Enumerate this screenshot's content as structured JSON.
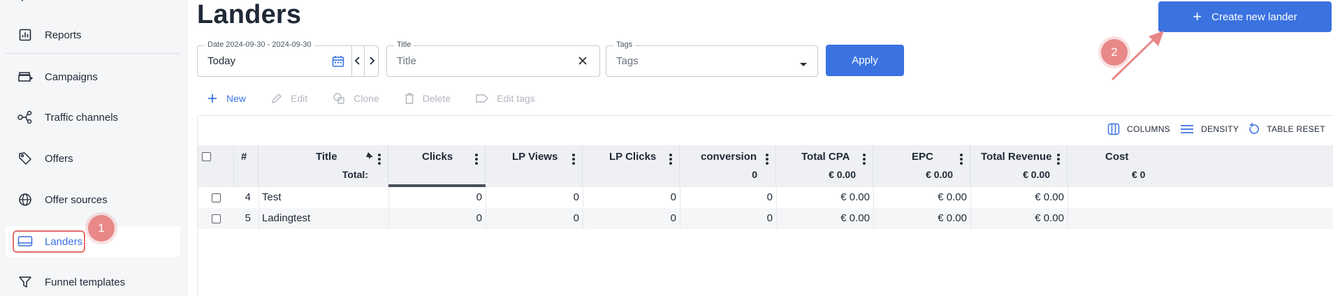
{
  "sidebar": {
    "items": [
      {
        "label": "Reports",
        "icon": "bar-chart-icon"
      },
      {
        "label": "Campaigns",
        "icon": "campaign-icon"
      },
      {
        "label": "Traffic channels",
        "icon": "share-nodes-icon"
      },
      {
        "label": "Offers",
        "icon": "tag-icon"
      },
      {
        "label": "Offer sources",
        "icon": "globe-icon"
      },
      {
        "label": "Landers",
        "icon": "monitor-icon"
      },
      {
        "label": "Funnel templates",
        "icon": "filter-icon"
      }
    ],
    "active": "Landers"
  },
  "annotations": {
    "badge_1": "1",
    "badge_2": "2"
  },
  "page": {
    "title": "Landers"
  },
  "create_button": {
    "label": "Create new lander"
  },
  "filters": {
    "date": {
      "label": "Date 2024-09-30 - 2024-09-30",
      "value": "Today"
    },
    "title": {
      "label": "Title",
      "placeholder": "Title"
    },
    "tags": {
      "label": "Tags",
      "placeholder": "Tags"
    },
    "apply_label": "Apply"
  },
  "toolbar": {
    "new": "New",
    "edit": "Edit",
    "clone": "Clone",
    "delete": "Delete",
    "edit_tags": "Edit tags"
  },
  "table_tools": {
    "columns": "COLUMNS",
    "density": "DENSITY",
    "reset": "TABLE RESET"
  },
  "table": {
    "columns": {
      "hash": "#",
      "title": "Title",
      "clicks": "Clicks",
      "lp_views": "LP Views",
      "lp_clicks": "LP Clicks",
      "conversion": "conversion",
      "total_cpa": "Total CPA",
      "epc": "EPC",
      "total_revenue": "Total Revenue",
      "cost": "Cost"
    },
    "totals": {
      "label": "Total:",
      "conversion": "0",
      "total_cpa": "€ 0.00",
      "epc": "€ 0.00",
      "total_revenue": "€ 0.00",
      "cost": "€ 0"
    },
    "rows": [
      {
        "id": "4",
        "title": "Test",
        "clicks": "0",
        "lp_views": "0",
        "lp_clicks": "0",
        "conversion": "0",
        "total_cpa": "€ 0.00",
        "epc": "€ 0.00",
        "total_revenue": "€ 0.00"
      },
      {
        "id": "5",
        "title": "Ladingtest",
        "clicks": "0",
        "lp_views": "0",
        "lp_clicks": "0",
        "conversion": "0",
        "total_cpa": "€ 0.00",
        "epc": "€ 0.00",
        "total_revenue": "€ 0.00"
      }
    ]
  },
  "colors": {
    "accent": "#3a72e0",
    "annotation": "#e88888"
  }
}
